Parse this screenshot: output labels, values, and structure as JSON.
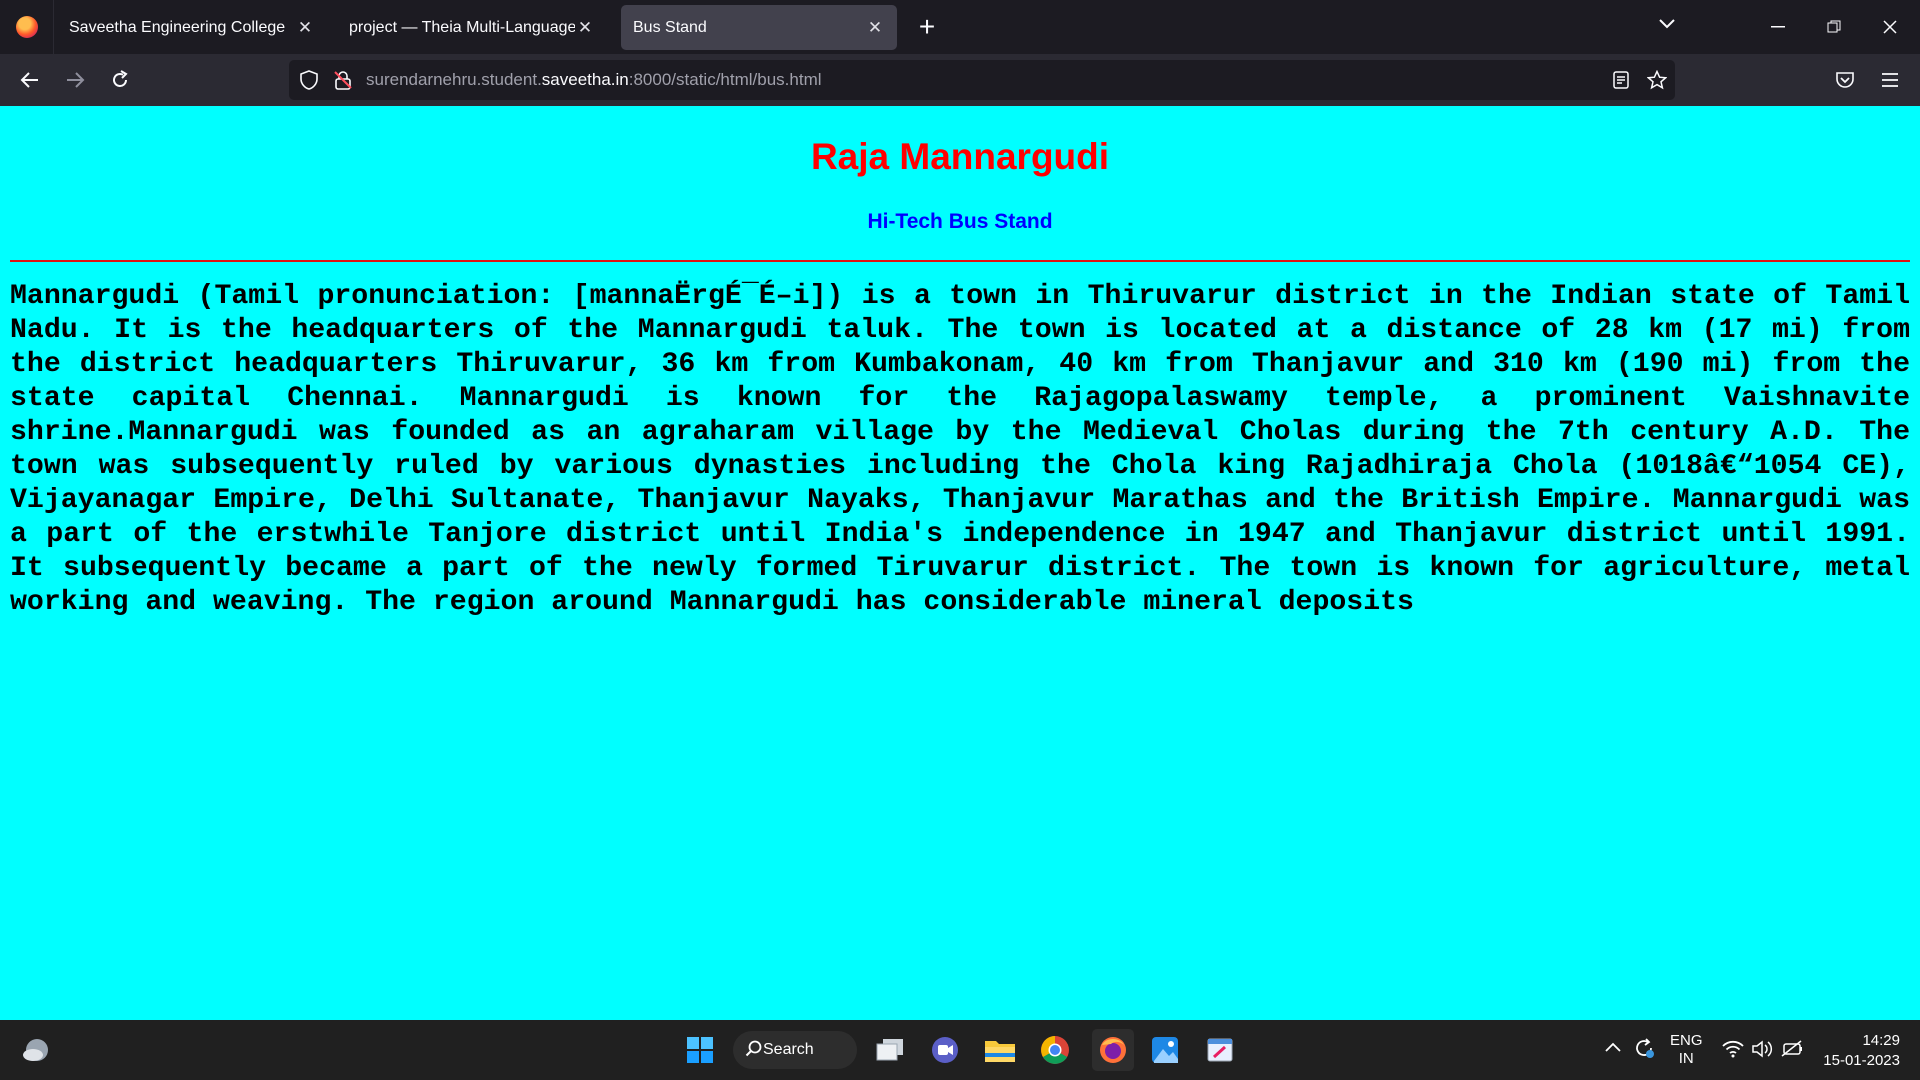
{
  "browser": {
    "tabs": [
      {
        "label": "Saveetha Engineering College",
        "active": false
      },
      {
        "label": "project — Theia Multi-Language Ex",
        "active": false
      },
      {
        "label": "Bus Stand",
        "active": true
      }
    ],
    "url": {
      "prefix": "surendarnehru.student.",
      "host": "saveetha.in",
      "suffix": ":8000/static/html/bus.html"
    }
  },
  "page": {
    "title": "Raja Mannargudi",
    "subtitle": "Hi-Tech Bus Stand",
    "paragraph": "Mannargudi (Tamil pronunciation: [mannaËrgÉ¯É–i]) is a town in Thiruvarur district in the Indian state of Tamil Nadu. It is the headquarters of the Mannargudi taluk. The town is located at a distance of 28 km (17 mi) from the district headquarters Thiruvarur, 36 km from Kumbakonam, 40 km from Thanjavur and 310 km (190 mi) from the state capital Chennai. Mannargudi is known for the Rajagopalaswamy temple, a prominent Vaishnavite shrine.Mannargudi was founded as an agraharam village by the Medieval Cholas during the 7th century A.D. The town was subsequently ruled by various dynasties including the Chola king Rajadhiraja Chola (1018â€“1054 CE), Vijayanagar Empire, Delhi Sultanate, Thanjavur Nayaks, Thanjavur Marathas and the British Empire. Mannargudi was a part of the erstwhile Tanjore district until India's independence in 1947 and Thanjavur district until 1991. It subsequently became a part of the newly formed Tiruvarur district. The town is known for agriculture, metal working and weaving. The region around Mannargudi has considerable mineral deposits"
  },
  "taskbar": {
    "search_label": "Search",
    "lang_top": "ENG",
    "lang_bottom": "IN",
    "time": "14:29",
    "date": "15-01-2023"
  },
  "colors": {
    "page_background": "#00ffff",
    "title": "#ff0000",
    "subtitle": "#0000ff",
    "rule": "#dd1111"
  }
}
